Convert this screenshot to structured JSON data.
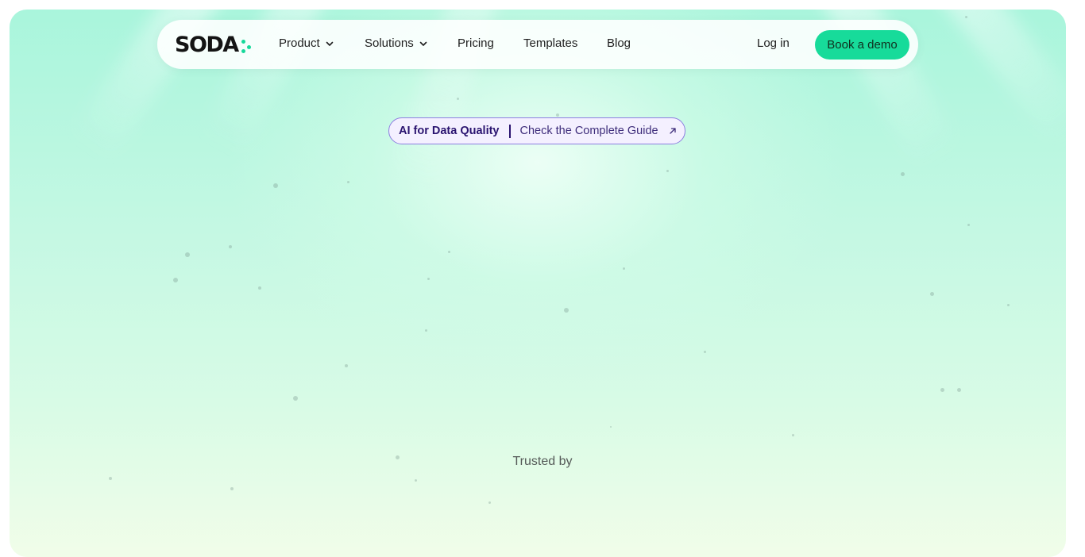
{
  "brand": {
    "logo_text": "SODA",
    "accent": "#17db9a",
    "logo_dots_icon": "three-dots-icon"
  },
  "nav": {
    "items": [
      {
        "label": "Product",
        "has_dropdown": true
      },
      {
        "label": "Solutions",
        "has_dropdown": true
      },
      {
        "label": "Pricing",
        "has_dropdown": false
      },
      {
        "label": "Templates",
        "has_dropdown": false
      },
      {
        "label": "Blog",
        "has_dropdown": false
      }
    ],
    "login_label": "Log in",
    "cta_label": "Book a demo",
    "chevron_icon": "chevron-down-icon"
  },
  "announcement": {
    "strong": "AI for Data Quality",
    "link": "Check the Complete Guide",
    "icon": "arrow-up-right-icon",
    "border_color": "#8d7ee0",
    "background": "#f4f0ff"
  },
  "hero": {
    "trusted_label": "Trusted by"
  },
  "colors": {
    "background_top": "#a9f5dc",
    "background_bottom": "#f1fde9",
    "text": "#1e1e1e"
  }
}
